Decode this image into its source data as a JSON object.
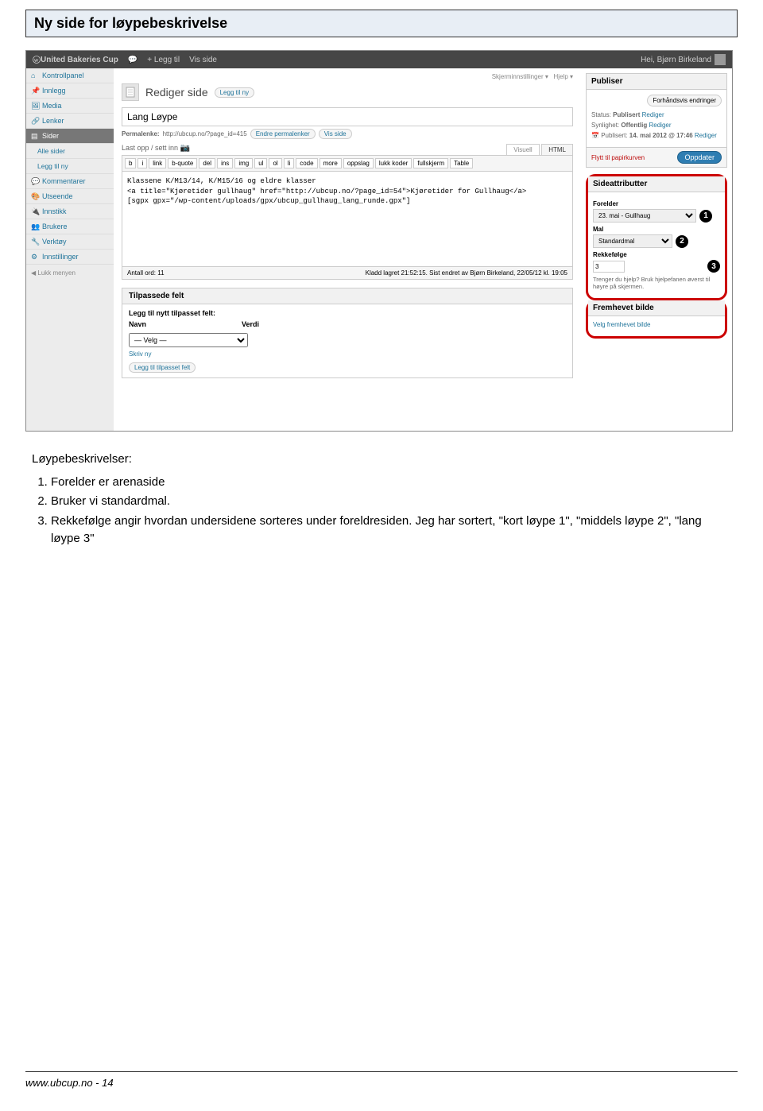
{
  "doc": {
    "section_title": "Ny side for løypebeskrivelse",
    "body_heading": "Løypebeskrivelser:",
    "list": [
      "Forelder er arenaside",
      "Bruker vi standardmal.",
      "Rekkefølge angir hvordan undersidene sorteres under foreldresiden. Jeg har sortert, \"kort løype 1\", \"middels løype 2\", \"lang løype 3\""
    ],
    "footer": "www.ubcup.no - 14"
  },
  "adminbar": {
    "site": "United Bakeries Cup",
    "new": "+ Legg til",
    "view": "Vis side",
    "greeting": "Hei, Bjørn Birkeland"
  },
  "sidebar": {
    "items": [
      "Kontrollpanel",
      "Innlegg",
      "Media",
      "Lenker",
      "Sider"
    ],
    "sub": [
      "Alle sider",
      "Legg til ny"
    ],
    "items2": [
      "Kommentarer",
      "Utseende",
      "Innstikk",
      "Brukere",
      "Verktøy",
      "Innstillinger"
    ],
    "collapse": "Lukk menyen"
  },
  "main": {
    "screen_opts": "Skjerminnstillinger ▾",
    "help": "Hjelp ▾",
    "heading": "Rediger side",
    "add_new": "Legg til ny",
    "title_value": "Lang Løype",
    "permalink_label": "Permalenke:",
    "permalink_url": "http://ubcup.no/?page_id=415",
    "permalink_edit": "Endre permalenker",
    "permalink_view": "Vis side",
    "upload_label": "Last opp / sett inn",
    "tabs": {
      "visual": "Visuell",
      "html": "HTML"
    },
    "ed_buttons": [
      "b",
      "i",
      "link",
      "b-quote",
      "del",
      "ins",
      "img",
      "ul",
      "ol",
      "li",
      "code",
      "more",
      "oppslag",
      "lukk koder",
      "fullskjerm",
      "Table"
    ],
    "content_l1": "Klassene K/M13/14, K/M15/16 og eldre klasser",
    "content_l2": "<a title=\"Kjøretider gullhaug\" href=\"http://ubcup.no/?page_id=54\">Kjøretider for Gullhaug</a>",
    "content_l3": "[sgpx gpx=\"/wp-content/uploads/gpx/ubcup_gullhaug_lang_runde.gpx\"]",
    "wordcount_label": "Antall ord:",
    "wordcount_val": "11",
    "autosave": "Kladd lagret 21:52:15. Sist endret av Bjørn Birkeland, 22/05/12 kl. 19:05",
    "cf_title": "Tilpassede felt",
    "cf_add_label": "Legg til nytt tilpasset felt:",
    "cf_name": "Navn",
    "cf_value": "Verdi",
    "cf_select": "— Velg —",
    "cf_enter": "Skriv ny",
    "cf_btn": "Legg til tilpasset felt"
  },
  "publish": {
    "title": "Publiser",
    "preview_btn": "Forhåndsvis endringer",
    "status_label": "Status:",
    "status_val": "Publisert",
    "edit": "Rediger",
    "vis_label": "Synlighet:",
    "vis_val": "Offentlig",
    "date_label": "Publisert:",
    "date_val": "14. mai 2012 @ 17:46",
    "trash": "Flytt til papirkurven",
    "update": "Oppdater"
  },
  "attrs": {
    "title": "Sideattributter",
    "parent_label": "Forelder",
    "parent_val": "   23. mai - Gullhaug",
    "tpl_label": "Mal",
    "tpl_val": "Standardmal",
    "order_label": "Rekkefølge",
    "order_val": "3",
    "help": "Trenger du hjelp? Bruk hjelpefanen øverst til høyre på skjermen."
  },
  "featured": {
    "title": "Fremhevet bilde",
    "link": "Velg fremhevet bilde"
  },
  "nums": {
    "n1": "1",
    "n2": "2",
    "n3": "3"
  }
}
